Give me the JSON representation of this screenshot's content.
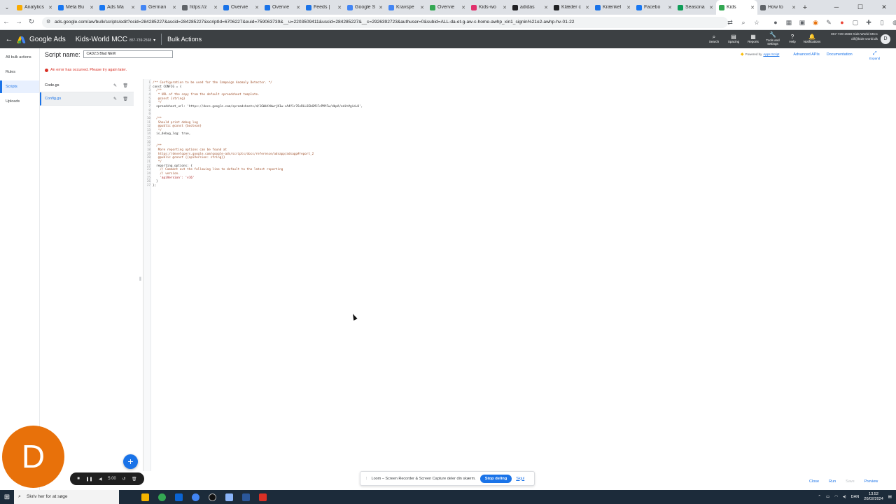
{
  "browser": {
    "tabs": [
      {
        "label": "Analytics",
        "color": "#f9ab00"
      },
      {
        "label": "Meta Bu",
        "color": "#1877f2"
      },
      {
        "label": "Ads Ma",
        "color": "#1877f2"
      },
      {
        "label": "German",
        "color": "#4285f4"
      },
      {
        "label": "https://z",
        "color": "#5f6368"
      },
      {
        "label": "Overvie",
        "color": "#1a73e8"
      },
      {
        "label": "Overvie",
        "color": "#1a73e8"
      },
      {
        "label": "Feeds |",
        "color": "#1a73e8"
      },
      {
        "label": "Google S",
        "color": "#4285f4"
      },
      {
        "label": "Kravspe",
        "color": "#4285f4"
      },
      {
        "label": "Overvie",
        "color": "#34a853"
      },
      {
        "label": "Kids-wo",
        "color": "#e1306c"
      },
      {
        "label": "adidas",
        "color": "#202124"
      },
      {
        "label": "Klæder c",
        "color": "#202124"
      },
      {
        "label": "Krænkel",
        "color": "#1a73e8"
      },
      {
        "label": "Facebo",
        "color": "#1877f2"
      },
      {
        "label": "Seasona",
        "color": "#0f9d58"
      },
      {
        "label": "Kids",
        "color": "#34a853",
        "active": true
      },
      {
        "label": "How to",
        "color": "#5f6368"
      }
    ],
    "url": "ads.google.com/aw/bulk/scripts/edit?ocid=284285227&ascid=284285227&scriptId=6706227&euid=759063739&__u=2203509411&uscid=284285227&__c=2926392723&authuser=0&subid=ALL-da-et-g-aw-c-home-awhp_xin1_signin%21o2-awhp-hv-01-22"
  },
  "header": {
    "product": "Google Ads",
    "account_name": "Kids-World MCC",
    "account_id": "857-739-2568",
    "page_title": "Bulk Actions",
    "tools": [
      {
        "label": "Search",
        "icon": "search-icon"
      },
      {
        "label": "Spacing",
        "icon": "spacing-icon"
      },
      {
        "label": "Reports",
        "icon": "reports-icon"
      },
      {
        "label": "Tools and settings",
        "icon": "wrench-icon"
      },
      {
        "label": "Help",
        "icon": "help-icon"
      },
      {
        "label": "Notifications",
        "icon": "bell-icon"
      }
    ],
    "account_line1": "857-739-2568 Kids-World MCC",
    "account_line2": "dif@kids-world.dk",
    "avatar_initial": "D"
  },
  "sidebar": {
    "items": [
      {
        "label": "All bulk actions"
      },
      {
        "label": "Rules"
      },
      {
        "label": "Scripts",
        "active": true
      },
      {
        "label": "Uploads"
      }
    ]
  },
  "script": {
    "name_label": "Script name:",
    "name_value": "CAD2.5 Blad NEW",
    "error": "An error has occurred. Please try again later.",
    "powered_by": "Powered by",
    "powered_link": "Apps Script",
    "advanced_apis": "Advanced APIs",
    "documentation": "Documentation",
    "expand": "Expand",
    "files": [
      {
        "name": "Code.gs"
      },
      {
        "name": "Config.gs",
        "active": true
      }
    ]
  },
  "code_lines": [
    {
      "n": "1",
      "text": "/** Configuration to be used for the Campaign Anomaly Detector. */",
      "kind": "comment"
    },
    {
      "n": "2",
      "text": "const CONFIG = {",
      "kind": "plain"
    },
    {
      "n": "3",
      "text": "  /**",
      "kind": "comment"
    },
    {
      "n": "4",
      "text": "   * URL of the copy from the default spreadsheet template.",
      "kind": "comment"
    },
    {
      "n": "5",
      "text": "   @const {string}",
      "kind": "comment"
    },
    {
      "n": "6",
      "text": "   */",
      "kind": "comment"
    },
    {
      "n": "7",
      "text": "  spreadsheet_url: 'https://docs.google.com/spreadsheets/d/1GWkXtWwrjK1w-sA4Y1r76vRLLOEbGMlFcPMfFw/dbpA/edit#gid=0',",
      "kind": "plain"
    },
    {
      "n": "8",
      "text": "",
      "kind": "plain"
    },
    {
      "n": "9",
      "text": "",
      "kind": "plain"
    },
    {
      "n": "10",
      "text": "  /**",
      "kind": "comment"
    },
    {
      "n": "11",
      "text": "   Should print debug log",
      "kind": "comment"
    },
    {
      "n": "12",
      "text": "   @public @const {boolean}",
      "kind": "comment"
    },
    {
      "n": "13",
      "text": "   */",
      "kind": "comment"
    },
    {
      "n": "14",
      "text": "  is_debug_log: true,",
      "kind": "plain"
    },
    {
      "n": "15",
      "text": "",
      "kind": "plain"
    },
    {
      "n": "16",
      "text": "",
      "kind": "plain"
    },
    {
      "n": "17",
      "text": "  /**",
      "kind": "comment"
    },
    {
      "n": "18",
      "text": "   More reporting options can be found at",
      "kind": "comment"
    },
    {
      "n": "19",
      "text": "   https://developers.google.com/google-ads/scripts/docs/reference/adsapp/adsapp#report_2",
      "kind": "comment"
    },
    {
      "n": "20",
      "text": "   @public @const {{apiVersion: string}}",
      "kind": "comment"
    },
    {
      "n": "21",
      "text": "   */",
      "kind": "comment"
    },
    {
      "n": "22",
      "text": "  reporting_options: {",
      "kind": "plain"
    },
    {
      "n": "23",
      "text": "    // Comment out the following line to default to the latest reporting",
      "kind": "comment"
    },
    {
      "n": "24",
      "text": "    // version.",
      "kind": "comment"
    },
    {
      "n": "25",
      "text": "    'apiVersion': 'v16'",
      "kind": "string"
    },
    {
      "n": "26",
      "text": "  }",
      "kind": "plain"
    },
    {
      "n": "27",
      "text": "};",
      "kind": "plain"
    }
  ],
  "footer": {
    "close": "Close",
    "run": "Run",
    "save": "Save",
    "preview": "Preview"
  },
  "loom": {
    "avatar_initial": "D",
    "timer": "5:00",
    "share_text": "Loom – Screen Recorder & Screen Capture deler din skærm.",
    "stop_label": "Stop deling",
    "hide_label": "Skjul"
  },
  "taskbar": {
    "search_placeholder": "Skriv her for at søge",
    "language": "DAN",
    "time": "13.52",
    "date": "20/02/2024"
  }
}
